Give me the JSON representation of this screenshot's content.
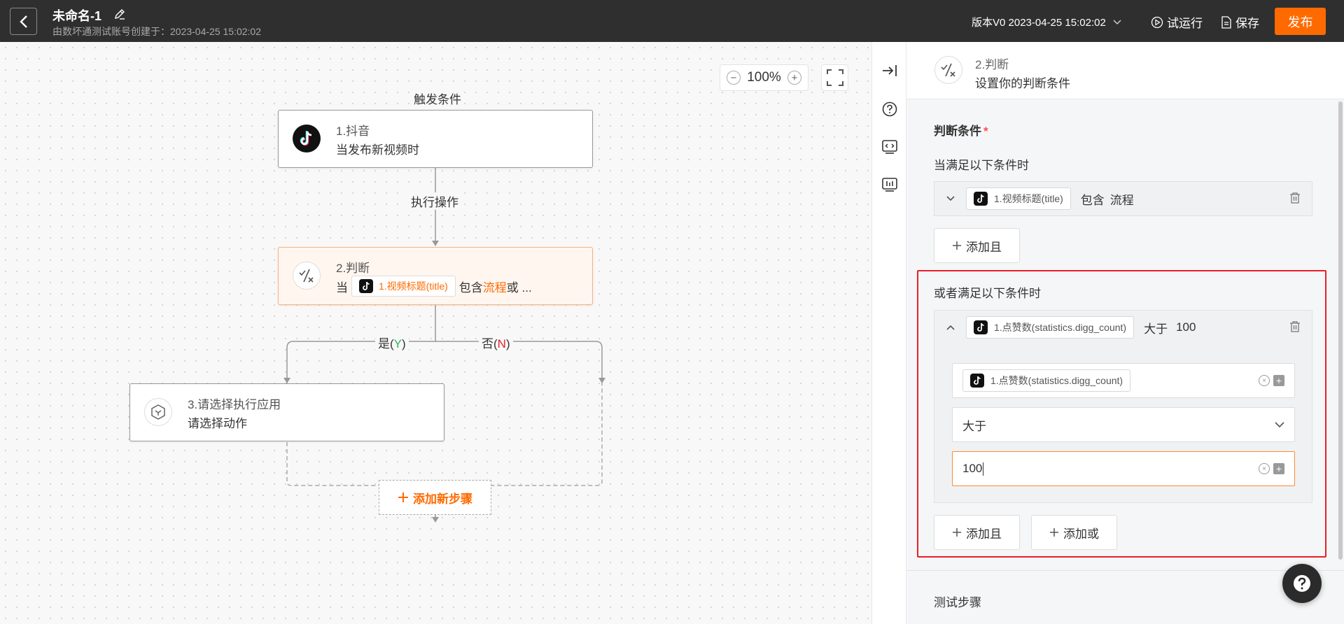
{
  "header": {
    "title": "未命名-1",
    "subtitle": "由数坏通测试账号创建于：2023-04-25 15:02:02",
    "version": "版本V0 2023-04-25 15:02:02",
    "test_run": "试运行",
    "save": "保存",
    "publish": "发布"
  },
  "canvas": {
    "zoom": "100%",
    "trigger_label": "触发条件",
    "action_label": "执行操作",
    "yes_prefix": "是(",
    "yes_letter": "Y",
    "yes_suffix": ")",
    "no_prefix": "否(",
    "no_letter": "N",
    "no_suffix": ")",
    "add_step": "添加新步骤",
    "nodes": [
      {
        "title": "1.抖音",
        "desc": "当发布新视频时"
      },
      {
        "title": "2.判断",
        "desc_prefix": "当",
        "chip": "1.视频标题(title)",
        "desc_mid": "包含",
        "desc_keyword": "流程",
        "desc_suffix": "或 ..."
      },
      {
        "title": "3.请选择执行应用",
        "desc": "请选择动作"
      }
    ]
  },
  "panel": {
    "header_title": "2.判断",
    "header_sub": "设置你的判断条件",
    "section_label": "判断条件",
    "required_mark": "*",
    "group1_label": "当满足以下条件时",
    "group1_rule": {
      "field": "1.视频标题(title)",
      "operator": "包含",
      "value": "流程"
    },
    "add_and": "添加且",
    "group2_label": "或者满足以下条件时",
    "group2_rule": {
      "field": "1.点赞数(statistics.digg_count)",
      "operator": "大于",
      "value": "100"
    },
    "edit_field": "1.点赞数(statistics.digg_count)",
    "edit_operator": "大于",
    "edit_value": "100",
    "add_and_2": "添加且",
    "add_or": "添加或",
    "test_step": "测试步骤"
  },
  "colors": {
    "accent": "#ff6a00",
    "highlight": "#e8202a",
    "yes": "#2db84d",
    "no": "#e8202a"
  }
}
